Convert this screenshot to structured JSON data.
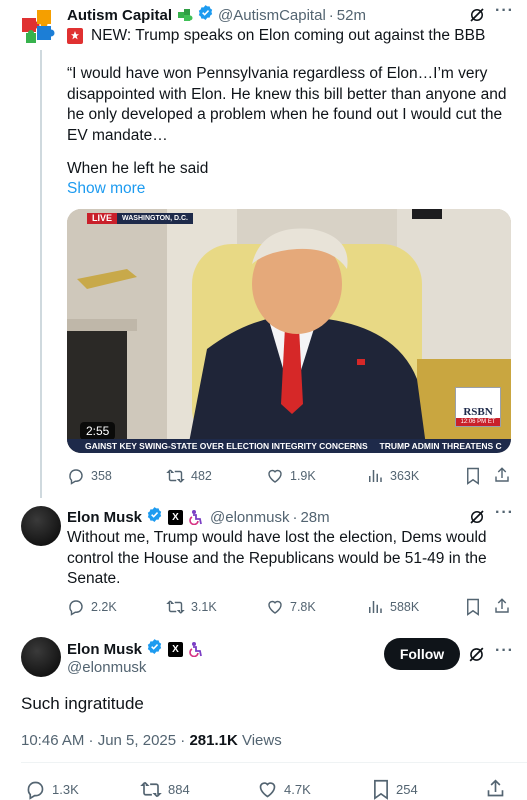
{
  "tweet1": {
    "author_name": "Autism Capital",
    "handle": "@AutismCapital",
    "time": "52m",
    "text_line1": "NEW: Trump speaks on Elon coming out against the BBB",
    "quote_lines": [
      "“I would have won Pennsylvania regardless of Elon…I’m very",
      "disappointed with Elon. He knew this bill better than anyone and",
      "he only developed a problem when he found out I would cut the",
      "EV mandate…"
    ],
    "quote_tail": "When he left he said",
    "show_more": "Show more",
    "media": {
      "live_label": "LIVE",
      "location": "WASHINGTON, D.C.",
      "duration": "2:55",
      "ticker": "GAINST KEY SWING-STATE OVER ELECTION INTEGRITY CONCERNS     TRUMP ADMIN THREATENS C",
      "network": "RSBN",
      "clock": "12:06 PM ET"
    },
    "stats": {
      "replies": "358",
      "reposts": "482",
      "likes": "1.9K",
      "views": "363K"
    }
  },
  "tweet2": {
    "author_name": "Elon Musk",
    "badge_letter": "X",
    "handle": "@elonmusk",
    "time": "28m",
    "lines": [
      "Without me, Trump would have lost the election, Dems would",
      "control the House and the Republicans would be 51-49 in the",
      "Senate."
    ],
    "stats": {
      "replies": "2.2K",
      "reposts": "3.1K",
      "likes": "7.8K",
      "views": "588K"
    }
  },
  "tweet3": {
    "author_name": "Elon Musk",
    "badge_letter": "X",
    "handle": "@elonmusk",
    "follow_label": "Follow",
    "text": "Such ingratitude",
    "timestamp": "10:46 AM · Jun 5, 2025 · ",
    "views_count": "281.1K",
    "views_label": " Views",
    "stats": {
      "replies": "1.3K",
      "reposts": "884",
      "likes": "4.7K",
      "bookmarks": "254"
    }
  },
  "colors": {
    "verified_blue": "#1d9bf0",
    "muted": "#536471",
    "link": "#1d9bf0",
    "text": "#0f1419"
  }
}
